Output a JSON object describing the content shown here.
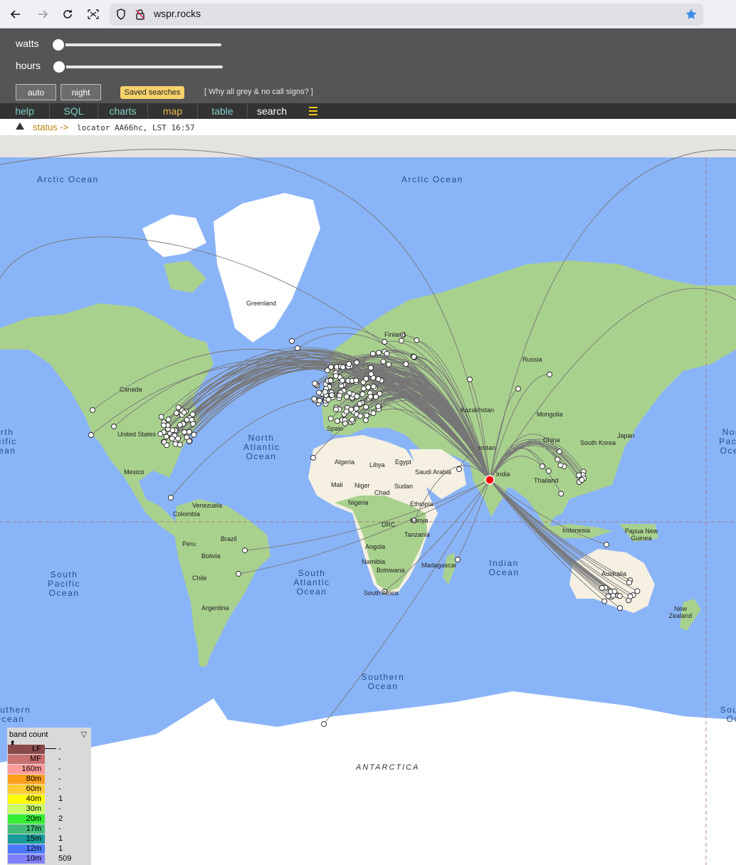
{
  "browser": {
    "url": "wspr.rocks",
    "icons": [
      "back-arrow-icon",
      "forward-arrow-icon",
      "reload-icon",
      "screenshot-icon",
      "shield-icon",
      "insecure-lock-icon",
      "bookmark-star-icon"
    ],
    "star_color": "#3b8eea"
  },
  "controls": {
    "watts_label": "watts",
    "watts_value": 0,
    "hours_label": "hours",
    "hours_value": 0,
    "auto_label": "auto",
    "night_label": "night",
    "saved_searches_label": "Saved searches",
    "why_grey_label": "[ Why all grey & no call signs? ]"
  },
  "tabs": [
    {
      "label": "help"
    },
    {
      "label": "SQL"
    },
    {
      "label": "charts"
    },
    {
      "label": "map"
    },
    {
      "label": "table"
    },
    {
      "label": "search"
    }
  ],
  "status": {
    "label": "status ->",
    "text": "locator AA66hc, LST 16:57"
  },
  "map": {
    "labels": {
      "oceans": {
        "arctic_left": "Arctic Ocean",
        "arctic_right": "Arctic Ocean",
        "north_atlantic": "North Atlantic Ocean",
        "north_pacific_right": "North Pacific Ocean",
        "north_pacific_left": "North Pacific Ocean",
        "south_pacific": "South Pacific Ocean",
        "south_atlantic": "South Atlantic Ocean",
        "indian": "Indian Ocean",
        "southern": "Southern Ocean",
        "southern_left": "Southern Ocean",
        "southern_right": "Southern Ocean"
      },
      "places": {
        "greenland": "Greenland",
        "canada": "Canada",
        "united_states": "United States",
        "mexico": "Mexico",
        "venezuela": "Venezuela",
        "colombia": "Colombia",
        "brazil": "Brazil",
        "peru": "Peru",
        "bolivia": "Bolivia",
        "chile": "Chile",
        "argentina": "Argentina",
        "russia": "Russia",
        "finland": "Finland",
        "kazakhstan": "Kazakhstan",
        "mongolia": "Mongolia",
        "china": "China",
        "japan": "Japan",
        "south_korea": "South Korea",
        "india": "India",
        "thailand": "Thailand",
        "indonesia": "Indonesia",
        "papua": "Papua New Guinea",
        "australia": "Australia",
        "new_zealand": "New Zealand",
        "algeria": "Algeria",
        "libya": "Libya",
        "egypt": "Egypt",
        "saudi": "Saudi Arabia",
        "mali": "Mali",
        "niger": "Niger",
        "chad": "Chad",
        "sudan": "Sudan",
        "nigeria": "Nigeria",
        "ethiopia": "Ethiopia",
        "drc": "DRC",
        "kenya": "Kenya",
        "tanzania": "Tanzania",
        "angola": "Angola",
        "namibia": "Namibia",
        "botswana": "Botswana",
        "madagascar": "Madagascar",
        "south_africa": "South Africa",
        "spain": "Spain",
        "antarctica": "ANTARCTICA",
        "afghanistan": "nistan"
      }
    },
    "colors": {
      "water": "#8ab4f8",
      "land": "#a9d18e",
      "desert": "#f5f0e1",
      "ice": "#ffffff",
      "path": "#777777",
      "home": "#ff0000"
    }
  },
  "legend": {
    "title": "band count ⬍",
    "filter_icon": "▽",
    "bands": [
      {
        "name": "LF",
        "color": "#8b4a4a",
        "count": "-"
      },
      {
        "name": "MF",
        "color": "#c97070",
        "count": "-"
      },
      {
        "name": "160m",
        "color": "#ff9a9a",
        "count": "-"
      },
      {
        "name": "80m",
        "color": "#ff9f1a",
        "count": "-"
      },
      {
        "name": "60m",
        "color": "#ffcc33",
        "count": "-"
      },
      {
        "name": "40m",
        "color": "#ffff00",
        "count": "1"
      },
      {
        "name": "30m",
        "color": "#ccff66",
        "count": "-"
      },
      {
        "name": "20m",
        "color": "#33ee33",
        "count": "2"
      },
      {
        "name": "17m",
        "color": "#44bb77",
        "count": "-"
      },
      {
        "name": "15m",
        "color": "#1a9a9a",
        "count": "1"
      },
      {
        "name": "12m",
        "color": "#4f7aff",
        "count": "1"
      },
      {
        "name": "10m",
        "color": "#8080ff",
        "count": "509"
      }
    ]
  }
}
